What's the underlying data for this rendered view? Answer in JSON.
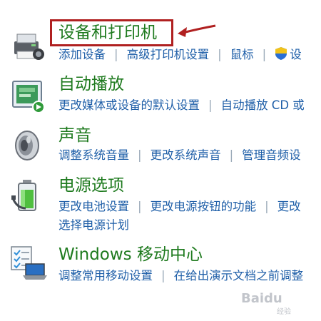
{
  "sections": [
    {
      "title": "设备和打印机",
      "icon": "printer-icon",
      "links": [
        "添加设备",
        "高级打印机设置",
        "鼠标",
        "设"
      ]
    },
    {
      "title": "自动播放",
      "icon": "autoplay-icon",
      "links": [
        "更改媒体或设备的默认设置",
        "自动播放 CD 或"
      ]
    },
    {
      "title": "声音",
      "icon": "speaker-icon",
      "links": [
        "调整系统音量",
        "更改系统声音",
        "管理音频设"
      ]
    },
    {
      "title": "电源选项",
      "icon": "battery-icon",
      "links": [
        "更改电池设置",
        "更改电源按钮的功能",
        "更改"
      ],
      "links2": [
        "选择电源计划"
      ]
    },
    {
      "title": "Windows 移动中心",
      "icon": "laptop-checklist-icon",
      "links": [
        "调整常用移动设置",
        "在给出演示文档之前调整"
      ]
    }
  ],
  "annotation": {
    "highlight_color": "#b02020",
    "arrow_icon": "red-arrow-icon"
  },
  "watermark": {
    "text": "Baidu",
    "sub": "经验"
  },
  "colors": {
    "title": "#1e7a1e",
    "link": "#1f5fa8",
    "separator": "#9aa9b8"
  }
}
